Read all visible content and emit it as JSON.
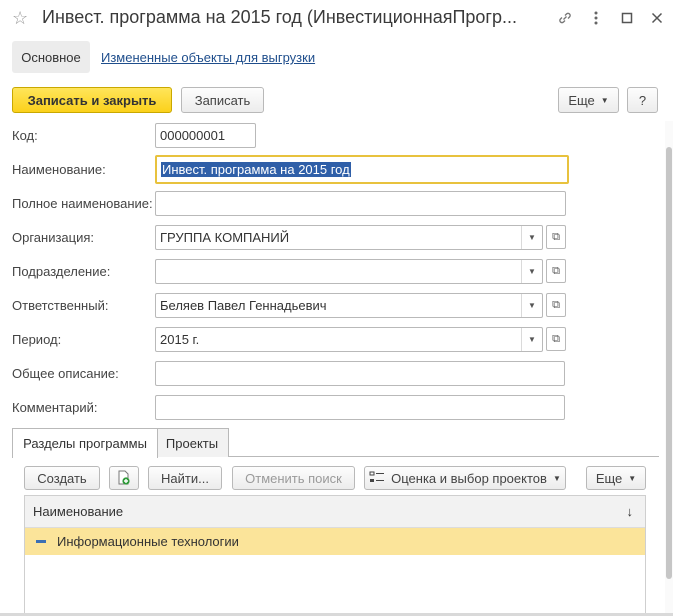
{
  "window": {
    "title": "Инвест. программа на 2015 год (ИнвестиционнаяПрогр...",
    "icons": [
      "star-icon",
      "link-icon",
      "more-vertical-icon",
      "maximize-icon",
      "close-icon"
    ]
  },
  "top_tabs": {
    "main": "Основное",
    "changed": "Измененные объекты для выгрузки"
  },
  "toolbar": {
    "save_close": "Записать и закрыть",
    "save": "Записать",
    "more": "Еще",
    "help": "?"
  },
  "form": {
    "code": {
      "label": "Код:",
      "value": "000000001"
    },
    "name": {
      "label": "Наименование:",
      "value": "Инвест. программа на 2015 год"
    },
    "full_name": {
      "label": "Полное наименование:",
      "value": ""
    },
    "organization": {
      "label": "Организация:",
      "value": "ГРУППА КОМПАНИЙ"
    },
    "department": {
      "label": "Подразделение:",
      "value": ""
    },
    "responsible": {
      "label": "Ответственный:",
      "value": "Беляев Павел Геннадьевич"
    },
    "period": {
      "label": "Период:",
      "value": "2015 г."
    },
    "description": {
      "label": "Общее описание:",
      "value": ""
    },
    "comment": {
      "label": "Комментарий:",
      "value": ""
    }
  },
  "sections_tabs": {
    "program_sections": "Разделы программы",
    "projects": "Проекты"
  },
  "table_toolbar": {
    "create": "Создать",
    "find": "Найти...",
    "cancel_search": "Отменить поиск",
    "evaluate": "Оценка и выбор проектов",
    "more": "Еще"
  },
  "table": {
    "column_name": "Наименование",
    "sort_indicator": "↓",
    "rows": [
      {
        "name": "Информационные технологии"
      }
    ]
  },
  "colors": {
    "primary_button": "#fbd11b",
    "focus_border": "#e8c23d",
    "selected_row": "#fbe49a",
    "link": "#1f4e8c"
  }
}
